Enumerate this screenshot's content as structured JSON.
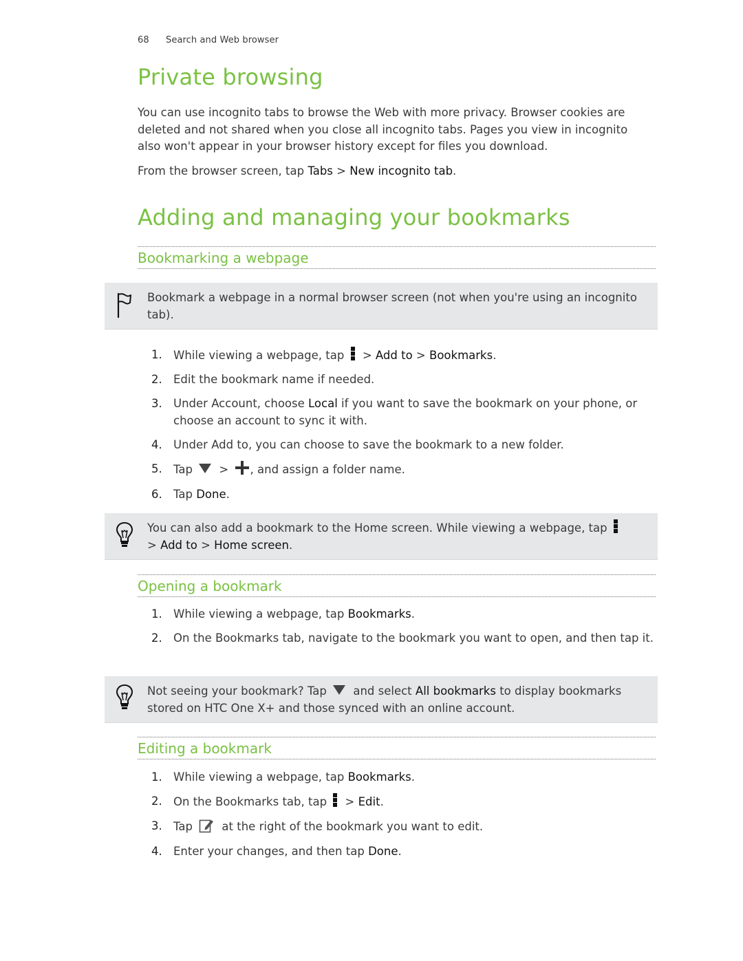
{
  "header": {
    "page_number": "68",
    "section": "Search and Web browser"
  },
  "private_browsing": {
    "title": "Private browsing",
    "paragraph": "You can use incognito tabs to browse the Web with more privacy. Browser cookies are deleted and not shared when you close all incognito tabs. Pages you view in incognito also won't appear in your browser history except for files you download.",
    "instruction_prefix": "From the browser screen, tap ",
    "instruction_tabs": "Tabs",
    "instruction_sep": " > ",
    "instruction_new_tab": "New incognito tab",
    "instruction_suffix": "."
  },
  "bookmarks": {
    "title": "Adding and managing your bookmarks",
    "bookmarking": {
      "heading": "Bookmarking a webpage",
      "note": {
        "icon": "flag-icon",
        "text": "Bookmark a webpage in a normal browser screen (not when you're using an incognito tab)."
      },
      "steps": [
        {
          "num": "1.",
          "pre": "While viewing a webpage, tap ",
          "after_icon": " > ",
          "b1": "Add to",
          "sep": " > ",
          "b2": "Bookmarks",
          "end": "."
        },
        {
          "num": "2.",
          "text": "Edit the bookmark name if needed."
        },
        {
          "num": "3.",
          "pre": "Under Account, choose ",
          "b1": "Local",
          "end": " if you want to save the bookmark on your phone, or choose an account to sync it with."
        },
        {
          "num": "4.",
          "text": "Under Add to, you can choose to save the bookmark to a new folder."
        },
        {
          "num": "5.",
          "pre": "Tap ",
          "mid": " > ",
          "end": ", and assign a folder name."
        },
        {
          "num": "6.",
          "pre": "Tap ",
          "b1": "Done",
          "end": "."
        }
      ],
      "tip": {
        "icon": "lightbulb-icon",
        "pre": "You can also add a bookmark to the Home screen. While viewing a webpage, tap ",
        "sep1": " > ",
        "b1": "Add to",
        "sep2": " > ",
        "b2": "Home screen",
        "end": "."
      }
    },
    "opening": {
      "heading": "Opening a bookmark",
      "steps": [
        {
          "num": "1.",
          "pre": "While viewing a webpage, tap ",
          "b1": "Bookmarks",
          "end": "."
        },
        {
          "num": "2.",
          "text": "On the Bookmarks tab, navigate to the bookmark you want to open, and then tap it."
        }
      ],
      "tip": {
        "icon": "lightbulb-icon",
        "pre": "Not seeing your bookmark? Tap ",
        "mid": " and select ",
        "b1": "All bookmarks",
        "end": " to display bookmarks stored on HTC One X+ and those synced with an online account."
      }
    },
    "editing": {
      "heading": "Editing a bookmark",
      "steps": [
        {
          "num": "1.",
          "pre": "While viewing a webpage, tap ",
          "b1": "Bookmarks",
          "end": "."
        },
        {
          "num": "2.",
          "pre": "On the Bookmarks tab, tap ",
          "sep": " > ",
          "b1": "Edit",
          "end": "."
        },
        {
          "num": "3.",
          "pre": "Tap ",
          "end": " at the right of the bookmark you want to edit."
        },
        {
          "num": "4.",
          "pre": "Enter your changes, and then tap ",
          "b1": "Done",
          "end": "."
        }
      ]
    }
  },
  "colors": {
    "accent_green": "#7ac143",
    "note_background": "#e6e7e8",
    "body_text": "#3a3a3a"
  }
}
